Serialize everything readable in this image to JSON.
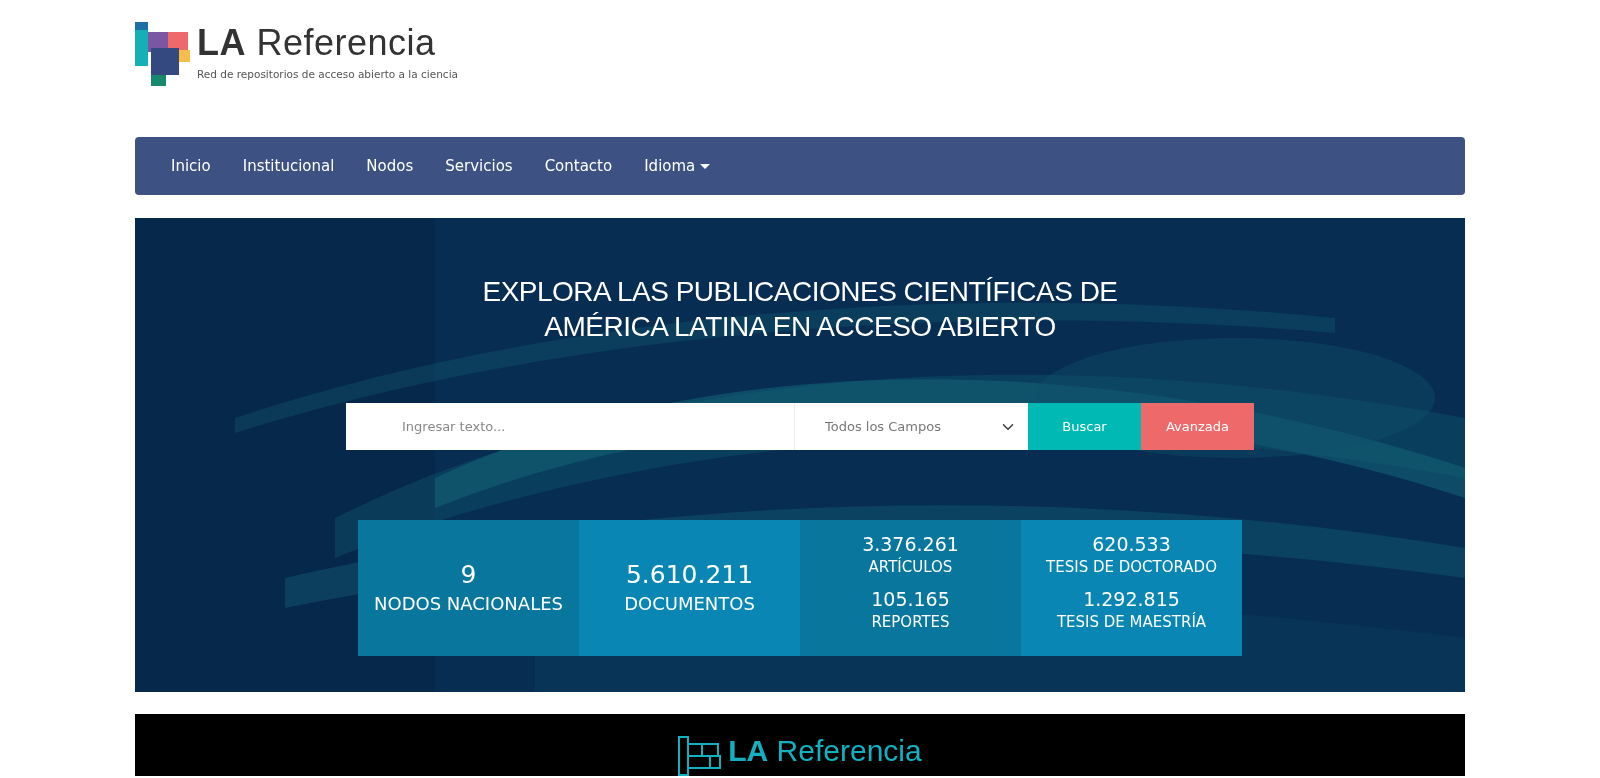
{
  "header": {
    "logo_title": "LA Referencia",
    "logo_tagline": "Red de repositorios de acceso abierto a la ciencia"
  },
  "navbar": {
    "items": [
      {
        "label": "Inicio",
        "dropdown": false
      },
      {
        "label": "Institucional",
        "dropdown": false
      },
      {
        "label": "Nodos",
        "dropdown": false
      },
      {
        "label": "Servicios",
        "dropdown": false
      },
      {
        "label": "Contacto",
        "dropdown": false
      },
      {
        "label": "Idioma",
        "dropdown": true
      }
    ]
  },
  "hero": {
    "title_lines": [
      "EXPLORA LAS PUBLICACIONES CIENTÍFICAS DE",
      "AMÉRICA LATINA EN ACCESO ABIERTO"
    ],
    "search": {
      "placeholder": "Ingresar texto...",
      "field_select": "Todos los Campos",
      "buttons": [
        {
          "label": "Buscar",
          "kind": "primary"
        },
        {
          "label": "Avanzada",
          "kind": "secondary"
        }
      ]
    },
    "stats": [
      {
        "kind": "single",
        "entries": [
          {
            "number": "9",
            "label": "NODOS NACIONALES"
          }
        ]
      },
      {
        "kind": "single",
        "entries": [
          {
            "number": "5.610.211",
            "label": "DOCUMENTOS"
          }
        ]
      },
      {
        "kind": "double",
        "entries": [
          {
            "number": "3.376.261",
            "label": "ARTÍCULOS"
          },
          {
            "number": "105.165",
            "label": "REPORTES"
          }
        ]
      },
      {
        "kind": "double",
        "entries": [
          {
            "number": "620.533",
            "label": "TESIS DE DOCTORADO"
          },
          {
            "number": "1.292.815",
            "label": "TESIS DE MAESTRÍA"
          }
        ]
      }
    ]
  },
  "footer": {
    "logo_title": "LA Referencia"
  }
}
